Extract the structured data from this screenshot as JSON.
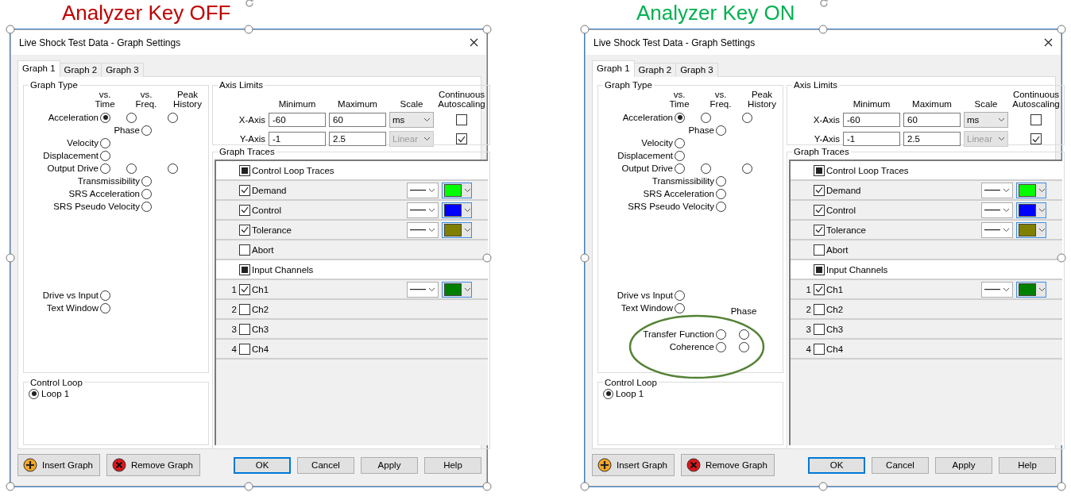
{
  "panels": [
    {
      "heading": "Analyzer Key OFF",
      "color": "#c00000",
      "selected": true,
      "dialog": {
        "title": "Live Shock Test Data - Graph Settings",
        "tabs": [
          {
            "label": "Graph 1",
            "selected": true
          },
          {
            "label": "Graph 2",
            "selected": false
          },
          {
            "label": "Graph 3",
            "selected": false
          }
        ],
        "graph_type": {
          "title": "Graph Type",
          "columns": [
            "vs. Time",
            "vs. Freq.",
            "Peak History"
          ],
          "rows": [
            {
              "label": "Acceleration",
              "kind": "time",
              "radios": [
                {
                  "selected": true
                },
                {
                  "selected": false
                },
                {
                  "selected": false
                }
              ]
            },
            {
              "label": "Phase",
              "kind": "freq",
              "radios": [
                {
                  "selected": false
                }
              ]
            },
            {
              "label": "Velocity",
              "kind": "time",
              "radios": [
                {
                  "selected": false
                }
              ]
            },
            {
              "label": "Displacement",
              "kind": "time",
              "radios": [
                {
                  "selected": false
                }
              ]
            },
            {
              "label": "Output Drive",
              "kind": "time",
              "radios": [
                {
                  "selected": false
                },
                {
                  "selected": false
                },
                {
                  "selected": false
                }
              ]
            },
            {
              "label": "Transmissibility",
              "kind": "freq",
              "radios": [
                {
                  "selected": false
                }
              ]
            },
            {
              "label": "SRS Acceleration",
              "kind": "freq",
              "radios": [
                {
                  "selected": false
                }
              ]
            },
            {
              "label": "SRS Pseudo Velocity",
              "kind": "freq",
              "radios": [
                {
                  "selected": false
                }
              ]
            }
          ],
          "lower_rows": [
            {
              "label": "Drive vs Input",
              "kind": "time",
              "radios": [
                {
                  "selected": false
                }
              ]
            },
            {
              "label": "Text Window",
              "kind": "time",
              "radios": [
                {
                  "selected": false
                }
              ]
            }
          ]
        },
        "axis_limits": {
          "title": "Axis Limits",
          "columns": [
            "Minimum",
            "Maximum",
            "Scale",
            "Continuous Autoscaling"
          ],
          "rows": [
            {
              "label": "X-Axis",
              "minimum": "-60",
              "maximum": "60",
              "scale": "ms",
              "scale_disabled": false,
              "autoscale": false
            },
            {
              "label": "Y-Axis",
              "minimum": "-1",
              "maximum": "2.5",
              "scale": "Linear",
              "scale_disabled": true,
              "autoscale": true
            }
          ]
        },
        "graph_traces": {
          "title": "Graph Traces",
          "rows": [
            {
              "kind": "group",
              "label": "Control Loop Traces",
              "checked": true
            },
            {
              "kind": "trace",
              "label": "Demand",
              "checked": true,
              "color": "#00ff00"
            },
            {
              "kind": "trace",
              "label": "Control",
              "checked": true,
              "color": "#0000ff"
            },
            {
              "kind": "trace",
              "label": "Tolerance",
              "checked": true,
              "color": "#808000"
            },
            {
              "kind": "trace",
              "label": "Abort",
              "checked": false
            },
            {
              "kind": "group",
              "label": "Input Channels",
              "checked": true
            },
            {
              "kind": "channel",
              "number": "1",
              "label": "Ch1",
              "checked": true,
              "color": "#008000"
            },
            {
              "kind": "channel",
              "number": "2",
              "label": "Ch2",
              "checked": false
            },
            {
              "kind": "channel",
              "number": "3",
              "label": "Ch3",
              "checked": false
            },
            {
              "kind": "channel",
              "number": "4",
              "label": "Ch4",
              "checked": false
            }
          ]
        },
        "control_loop": {
          "title": "Control Loop",
          "options": [
            {
              "label": "Loop 1",
              "selected": true
            }
          ]
        },
        "buttons": [
          {
            "label": "Insert Graph",
            "kind": "insert"
          },
          {
            "label": "Remove Graph",
            "kind": "remove"
          },
          {
            "label": "OK",
            "kind": "default"
          },
          {
            "label": "Cancel",
            "kind": "plain"
          },
          {
            "label": "Apply",
            "kind": "plain"
          },
          {
            "label": "Help",
            "kind": "plain"
          }
        ]
      }
    },
    {
      "heading": "Analyzer Key ON",
      "color": "#00b050",
      "selected": true,
      "dialog": {
        "title": "Live Shock Test Data - Graph Settings",
        "tabs": [
          {
            "label": "Graph 1",
            "selected": true
          },
          {
            "label": "Graph 2",
            "selected": false
          },
          {
            "label": "Graph 3",
            "selected": false
          }
        ],
        "graph_type": {
          "title": "Graph Type",
          "columns": [
            "vs. Time",
            "vs. Freq.",
            "Peak History"
          ],
          "rows": [
            {
              "label": "Acceleration",
              "kind": "time",
              "radios": [
                {
                  "selected": true
                },
                {
                  "selected": false
                },
                {
                  "selected": false
                }
              ]
            },
            {
              "label": "Phase",
              "kind": "freq",
              "radios": [
                {
                  "selected": false
                }
              ]
            },
            {
              "label": "Velocity",
              "kind": "time",
              "radios": [
                {
                  "selected": false
                }
              ]
            },
            {
              "label": "Displacement",
              "kind": "time",
              "radios": [
                {
                  "selected": false
                }
              ]
            },
            {
              "label": "Output Drive",
              "kind": "time",
              "radios": [
                {
                  "selected": false
                },
                {
                  "selected": false
                },
                {
                  "selected": false
                }
              ]
            },
            {
              "label": "Transmissibility",
              "kind": "freq",
              "radios": [
                {
                  "selected": false
                }
              ]
            },
            {
              "label": "SRS Acceleration",
              "kind": "freq",
              "radios": [
                {
                  "selected": false
                }
              ]
            },
            {
              "label": "SRS Pseudo Velocity",
              "kind": "freq",
              "radios": [
                {
                  "selected": false
                }
              ]
            }
          ],
          "lower_rows": [
            {
              "label": "Drive vs Input",
              "kind": "time",
              "radios": [
                {
                  "selected": false
                }
              ]
            },
            {
              "label": "Text Window",
              "kind": "time",
              "radios": [
                {
                  "selected": false
                }
              ]
            }
          ],
          "analyzer": {
            "header": "Phase",
            "circled": true,
            "rows": [
              {
                "label": "Transfer Function",
                "radios": [
                  {
                    "selected": false
                  },
                  {
                    "selected": false
                  }
                ]
              },
              {
                "label": "Coherence",
                "radios": [
                  {
                    "selected": false
                  },
                  {
                    "selected": false
                  }
                ]
              }
            ]
          }
        },
        "axis_limits": {
          "title": "Axis Limits",
          "columns": [
            "Minimum",
            "Maximum",
            "Scale",
            "Continuous Autoscaling"
          ],
          "rows": [
            {
              "label": "X-Axis",
              "minimum": "-60",
              "maximum": "60",
              "scale": "ms",
              "scale_disabled": false,
              "autoscale": false
            },
            {
              "label": "Y-Axis",
              "minimum": "-1",
              "maximum": "2.5",
              "scale": "Linear",
              "scale_disabled": true,
              "autoscale": true
            }
          ]
        },
        "graph_traces": {
          "title": "Graph Traces",
          "rows": [
            {
              "kind": "group",
              "label": "Control Loop Traces",
              "checked": true
            },
            {
              "kind": "trace",
              "label": "Demand",
              "checked": true,
              "color": "#00ff00"
            },
            {
              "kind": "trace",
              "label": "Control",
              "checked": true,
              "color": "#0000ff"
            },
            {
              "kind": "trace",
              "label": "Tolerance",
              "checked": true,
              "color": "#808000"
            },
            {
              "kind": "trace",
              "label": "Abort",
              "checked": false
            },
            {
              "kind": "group",
              "label": "Input Channels",
              "checked": true
            },
            {
              "kind": "channel",
              "number": "1",
              "label": "Ch1",
              "checked": true,
              "color": "#008000"
            },
            {
              "kind": "channel",
              "number": "2",
              "label": "Ch2",
              "checked": false
            },
            {
              "kind": "channel",
              "number": "3",
              "label": "Ch3",
              "checked": false
            },
            {
              "kind": "channel",
              "number": "4",
              "label": "Ch4",
              "checked": false
            }
          ]
        },
        "control_loop": {
          "title": "Control Loop",
          "options": [
            {
              "label": "Loop 1",
              "selected": true
            }
          ]
        },
        "buttons": [
          {
            "label": "Insert Graph",
            "kind": "insert"
          },
          {
            "label": "Remove Graph",
            "kind": "remove"
          },
          {
            "label": "OK",
            "kind": "default"
          },
          {
            "label": "Cancel",
            "kind": "plain"
          },
          {
            "label": "Apply",
            "kind": "plain"
          },
          {
            "label": "Help",
            "kind": "plain"
          }
        ]
      }
    }
  ]
}
